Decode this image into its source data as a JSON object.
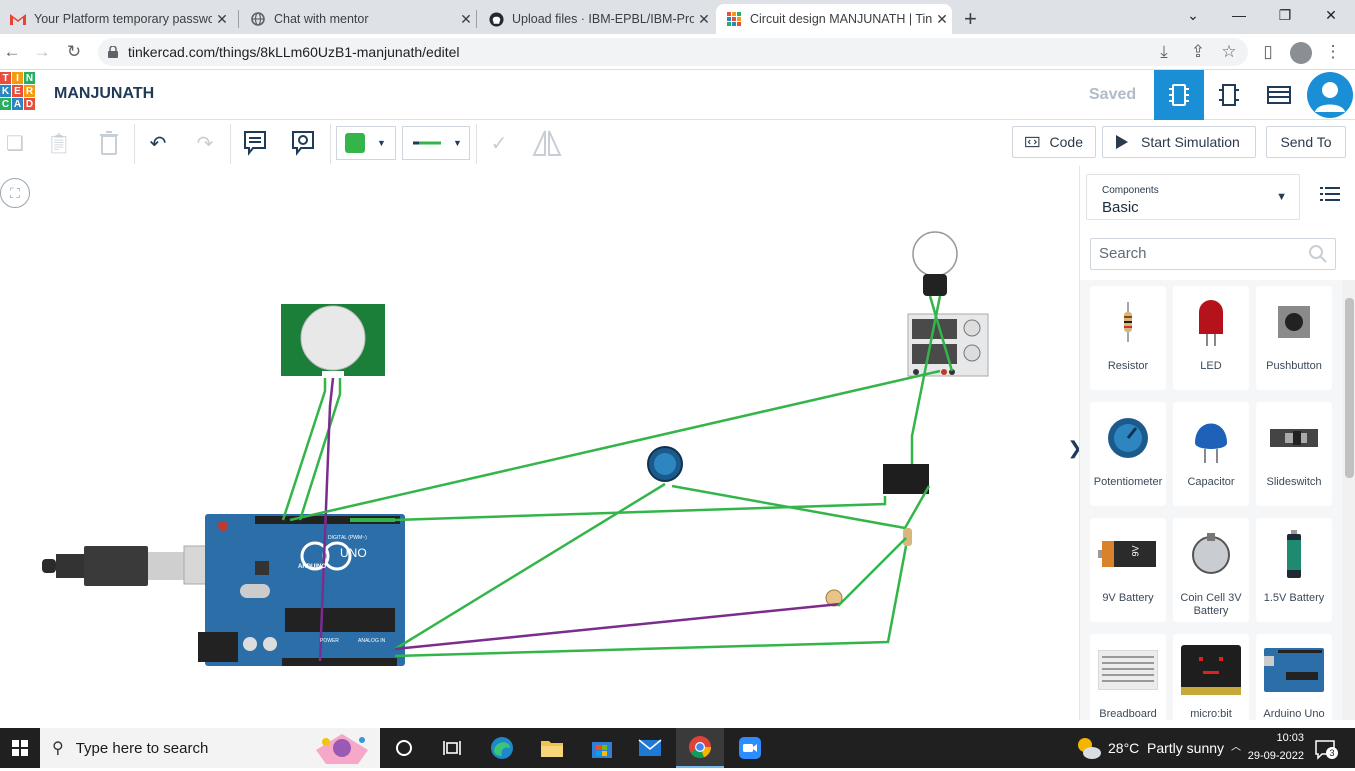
{
  "browser": {
    "tabs": [
      {
        "title": "Your Platform temporary passwo",
        "icon": "gmail-icon"
      },
      {
        "title": "Chat with mentor",
        "icon": "globe-icon"
      },
      {
        "title": "Upload files · IBM-EPBL/IBM-Proj",
        "icon": "github-icon"
      },
      {
        "title": "Circuit design MANJUNATH | Tin",
        "icon": "tinkercad-icon"
      }
    ],
    "url": "tinkercad.com/things/8kLLm60UzB1-manjunath/editel"
  },
  "tinkercad": {
    "logo_letters": [
      "T",
      "I",
      "N",
      "K",
      "E",
      "R",
      "C",
      "A",
      "D"
    ],
    "project_name": "MANJUNATH",
    "save_status": "Saved"
  },
  "toolbar": {
    "code_label": "Code",
    "start_simulation_label": "Start Simulation",
    "send_to_label": "Send To",
    "fill_color": "#33b54a"
  },
  "canvas": {
    "arduino_brand": "ARDUINO",
    "arduino_model": "UNO",
    "arduino_header_labels": [
      "DIGITAL (PWM~)",
      "POWER",
      "ANALOG IN"
    ],
    "battery_label": "9V"
  },
  "panel": {
    "components_label": "Components",
    "components_value": "Basic",
    "search_placeholder": "Search",
    "components": [
      {
        "name": "Resistor",
        "icon": "resistor-icon"
      },
      {
        "name": "LED",
        "icon": "led-icon"
      },
      {
        "name": "Pushbutton",
        "icon": "pushbutton-icon"
      },
      {
        "name": "Potentiometer",
        "icon": "potentiometer-icon"
      },
      {
        "name": "Capacitor",
        "icon": "capacitor-icon"
      },
      {
        "name": "Slideswitch",
        "icon": "slideswitch-icon"
      },
      {
        "name": "9V Battery",
        "icon": "battery-9v-icon"
      },
      {
        "name": "Coin Cell 3V Battery",
        "icon": "coin-cell-icon"
      },
      {
        "name": "1.5V Battery",
        "icon": "battery-1-5v-icon"
      },
      {
        "name": "Breadboard",
        "icon": "breadboard-icon"
      },
      {
        "name": "micro:bit",
        "icon": "microbit-icon"
      },
      {
        "name": "Arduino Uno",
        "icon": "arduino-uno-icon"
      }
    ]
  },
  "taskbar": {
    "search_placeholder": "Type here to search",
    "temperature": "28°C",
    "weather": "Partly sunny",
    "time": "10:03",
    "date": "29-09-2022",
    "notifications": "3"
  }
}
